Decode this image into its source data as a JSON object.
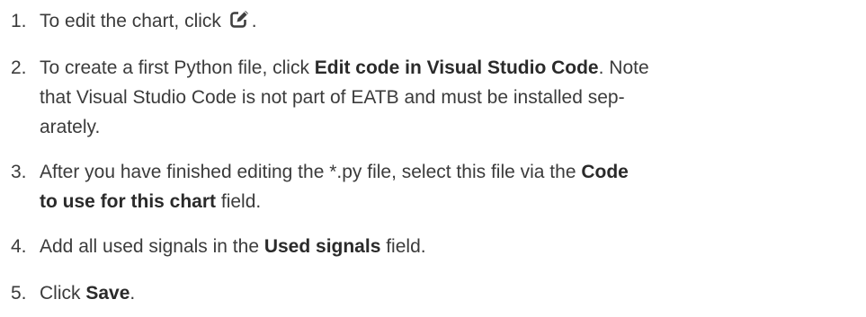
{
  "steps": [
    {
      "number": "1.",
      "before_icon": "To edit the chart, click ",
      "icon": "edit-icon",
      "after_icon": "."
    },
    {
      "number": "2.",
      "t1": "To create a first Python file, click ",
      "b1": "Edit code in Visual Studio Code",
      "t2": ". Note",
      "line2": "that Visual Studio Code is not part of EATB and must be installed sep-",
      "line3": "arately."
    },
    {
      "number": "3.",
      "t1": "After you have finished editing the *.py file, select this file via the ",
      "b1": "Code",
      "b2": "to use for this chart",
      "t2": " field."
    },
    {
      "number": "4.",
      "t1": "Add all used signals in the ",
      "b1": "Used signals",
      "t2": " field."
    },
    {
      "number": "5.",
      "t1": "Click ",
      "b1": "Save",
      "t2": "."
    }
  ]
}
